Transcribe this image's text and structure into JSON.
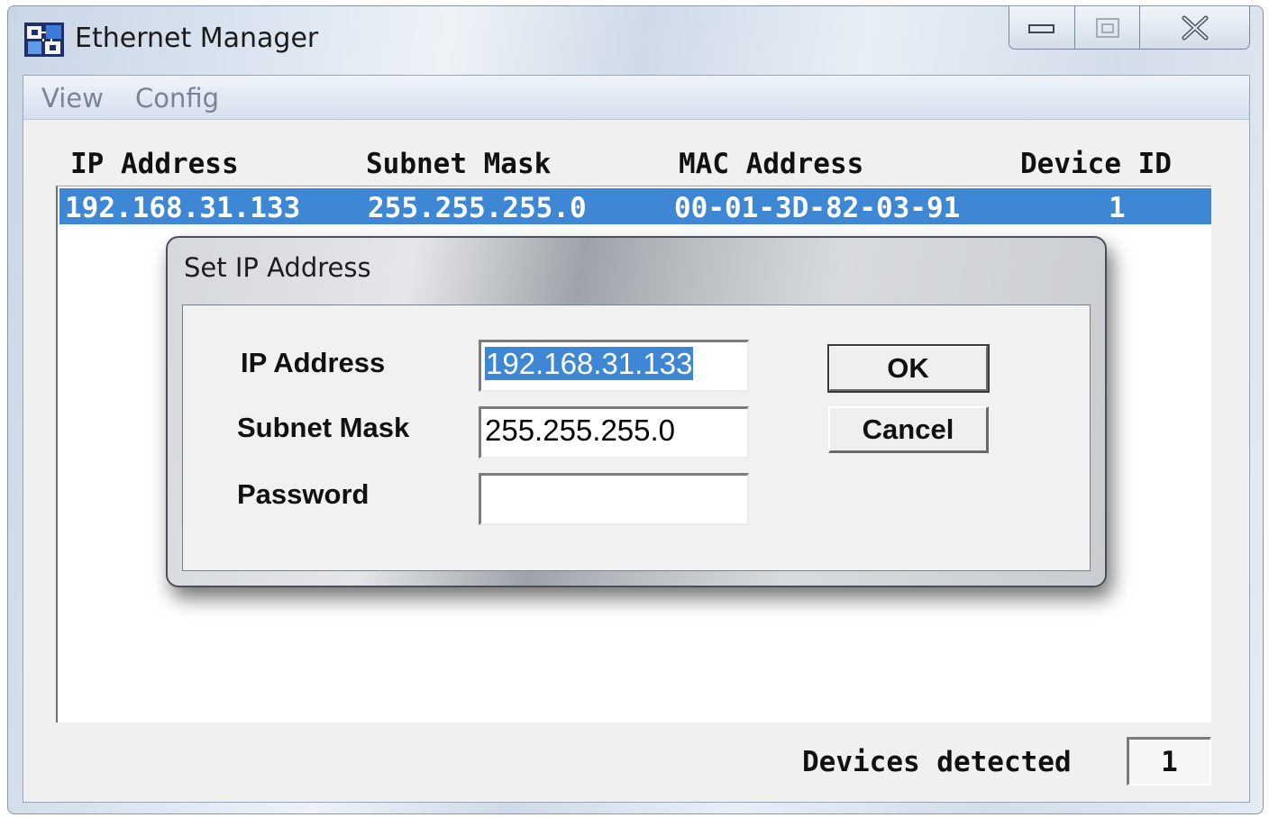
{
  "window": {
    "title": "Ethernet Manager",
    "icon": "network-app-icon"
  },
  "menu": {
    "view": "View",
    "config": "Config"
  },
  "table": {
    "columns": [
      "IP Address",
      "Subnet Mask",
      "MAC Address",
      "Device ID"
    ],
    "rows": [
      {
        "ip": "192.168.31.133",
        "subnet": "255.255.255.0",
        "mac": "00-01-3D-82-03-91",
        "device_id": "1",
        "selected": true
      }
    ]
  },
  "status": {
    "label": "Devices detected",
    "count": "1"
  },
  "dialog": {
    "title": "Set IP Address",
    "fields": {
      "ip": {
        "label": "IP Address",
        "value": "192.168.31.133"
      },
      "subnet": {
        "label": "Subnet Mask",
        "value": "255.255.255.0"
      },
      "password": {
        "label": "Password",
        "value": ""
      }
    },
    "ok_label": "OK",
    "cancel_label": "Cancel"
  },
  "colors": {
    "selection": "#3d87d4"
  }
}
